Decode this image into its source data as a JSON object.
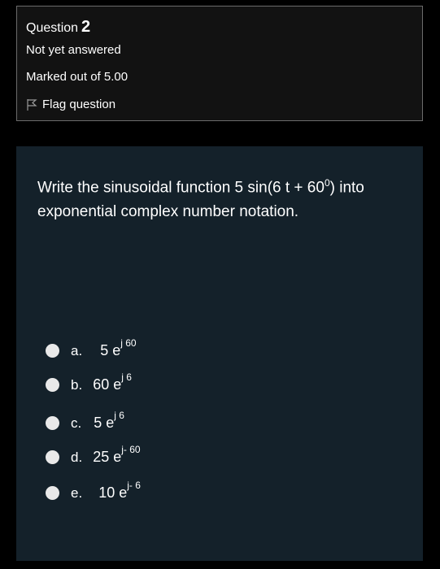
{
  "question_info": {
    "label": "Question",
    "number": "2",
    "status": "Not yet answered",
    "marks": "Marked out of 5.00",
    "flag_label": "Flag question"
  },
  "question": {
    "text_before": "Write the sinusoidal function 5 sin(6 t + 60",
    "degree": "0",
    "text_after": ")  into exponential complex number notation."
  },
  "options": [
    {
      "letter": "a.",
      "base": "5 e",
      "exp": "j 60"
    },
    {
      "letter": "b.",
      "base": "60 e",
      "exp": "j 6"
    },
    {
      "letter": "c.",
      "base": "5 e",
      "exp": "j 6"
    },
    {
      "letter": "d.",
      "base": "25 e",
      "exp": "j- 60"
    },
    {
      "letter": "e.",
      "base": "10 e",
      "exp": "j- 6"
    }
  ]
}
